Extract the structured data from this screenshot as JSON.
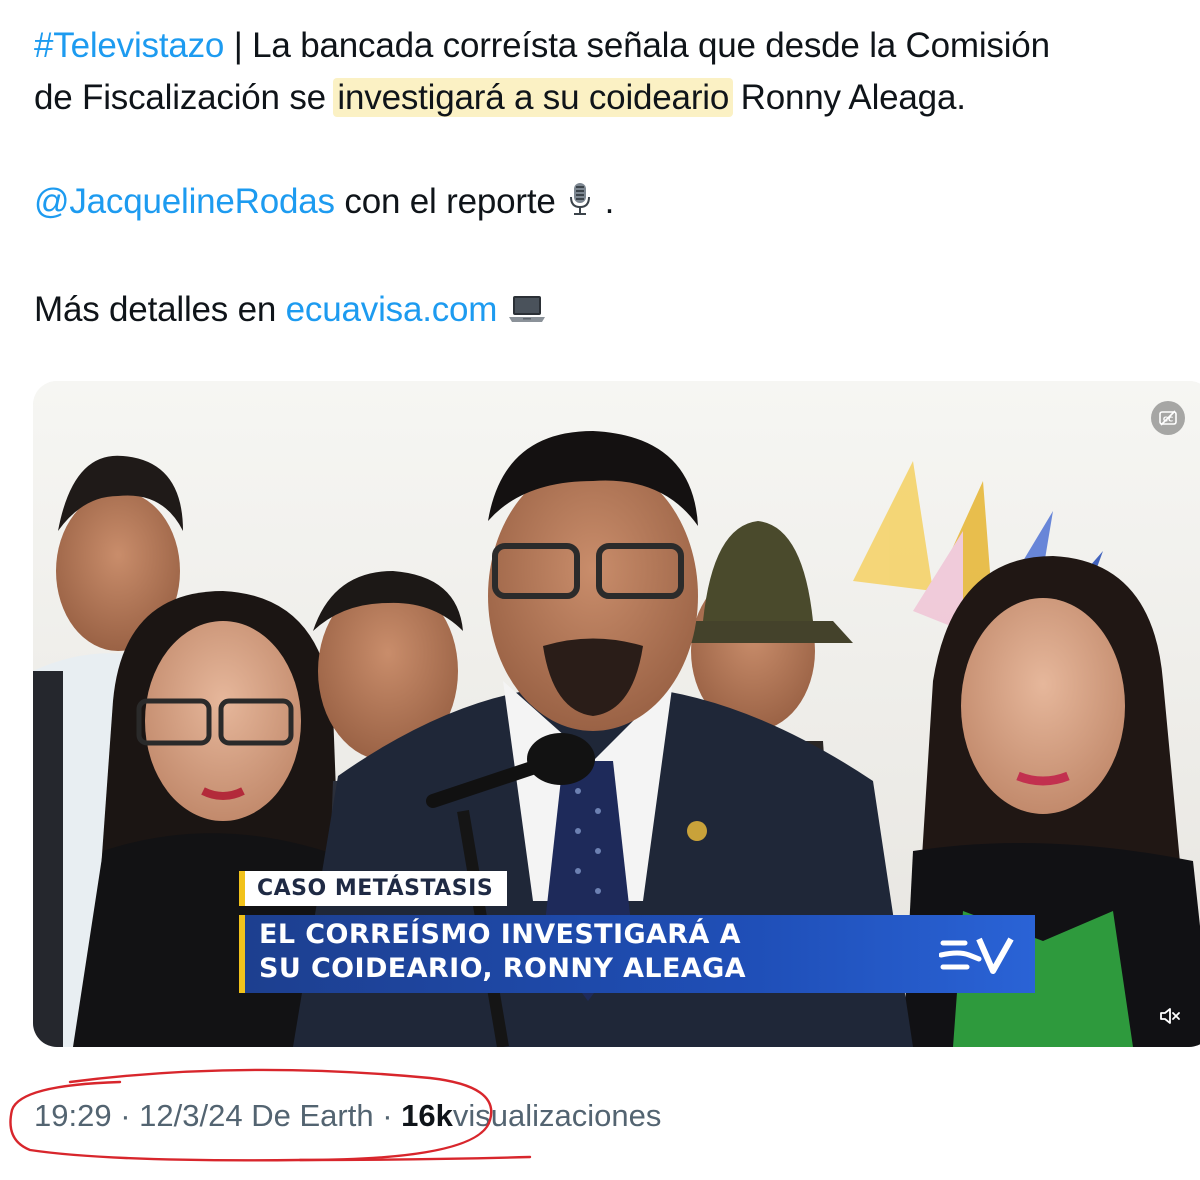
{
  "tweet": {
    "hashtag": "#Televistazo",
    "separator": "|",
    "text_1": "La bancada correísta señala que desde la Comisión",
    "text_2": "de Fiscalización se",
    "text_highlight": "investigará a su coideario",
    "text_3": "Ronny Aleaga.",
    "mention": "@JacquelineRodas",
    "mention_text": "con el reporte",
    "mention_emoji": "microphone-icon",
    "mention_end": ".",
    "details_text": "Más detalles en",
    "details_link": "ecuavisa.com",
    "details_emoji": "laptop-icon"
  },
  "media": {
    "caption_tag": "CASO METÁSTASIS",
    "caption_line_1": "EL CORREÍSMO INVESTIGARÁ A",
    "caption_line_2": "SU COIDEARIO, RONNY ALEAGA",
    "logo": "ecuavisa-logo",
    "caption_button": "closed-captions-icon",
    "mute_button": "mute-icon",
    "colors": {
      "caption_blue": "#1f4fb8",
      "caption_accent": "#f1c21b"
    }
  },
  "meta": {
    "time": "19:29",
    "dot_1": "·",
    "date": "12/3/24",
    "source": "De Earth",
    "dot_2": "·",
    "views_count": "16k",
    "views_label": "visualizaciones"
  },
  "colors": {
    "link": "#1d9bf0",
    "highlight": "#fbf1c4",
    "annotation": "#d8262c"
  }
}
